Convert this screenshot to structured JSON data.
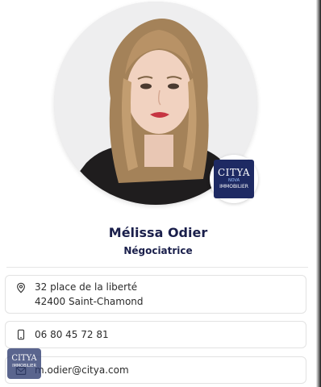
{
  "profile": {
    "name": "Mélissa Odier",
    "role": "Négociatrice",
    "photo": "portrait-photo"
  },
  "logo": {
    "brand": "CITYA",
    "line1": "NOVA",
    "line2": "IMMOBILIER"
  },
  "contact": {
    "address_line1": "32 place de la liberté",
    "address_line2": "42400 Saint-Chamond",
    "phone": "06 80 45 72 81",
    "email": "m.odier@citya.com",
    "address_icon": "location-pin-icon",
    "phone_icon": "mobile-phone-icon",
    "email_icon": "envelope-icon"
  },
  "watermark": {
    "brand": "CITYA",
    "sub": "IMMOBILIER"
  },
  "colors": {
    "brand_navy": "#1e2a63",
    "text_dark": "#1a1f4b"
  }
}
